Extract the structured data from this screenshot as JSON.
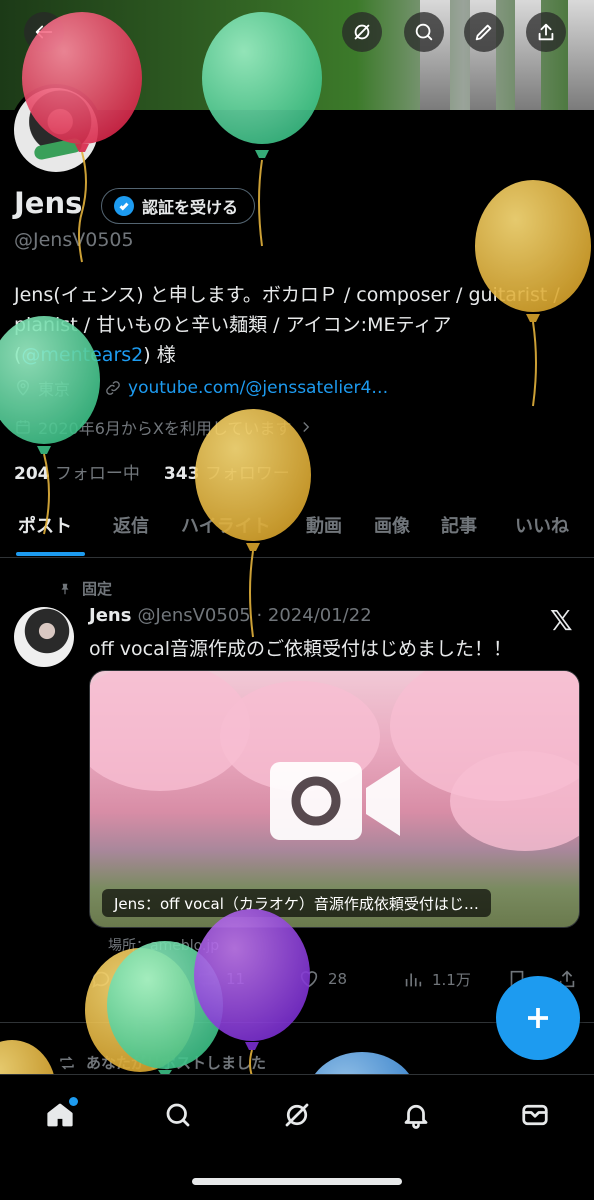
{
  "header": {
    "back_icon": "arrow-left-icon",
    "actions": [
      "grok-icon",
      "search-icon",
      "edit-icon",
      "share-icon"
    ]
  },
  "profile": {
    "name": "Jens",
    "verify_label": "認証を受ける",
    "handle": "@JensV0505",
    "bio_before": "Jens(イェンス) と申します。ボカロＰ / composer / guitarist / pianist / 甘いものと辛い麺類 / アイコン:MEティア (",
    "bio_mention": "@mentears2",
    "bio_after": ") 様",
    "location": "東京",
    "website": "youtube.com/@jenssatelier4…",
    "joined": "2020年6月からXを利用しています",
    "following_count": "204",
    "following_label": "フォロー中",
    "followers_count": "343",
    "followers_label": "フォロワー"
  },
  "tabs": [
    {
      "label": "ポスト",
      "active": true
    },
    {
      "label": "返信"
    },
    {
      "label": "ハイライト"
    },
    {
      "label": "動画"
    },
    {
      "label": "画像"
    },
    {
      "label": "記事"
    },
    {
      "label": "いいね"
    }
  ],
  "post": {
    "pinned_label": "固定",
    "author": "Jens",
    "handle_date": "@JensV0505 · 2024/01/22",
    "text": "off vocal音源作成のご依頼受付はじめました！！",
    "media_caption": "Jens：off vocal（カラオケ）音源作成依頼受付はじ…",
    "source": "場所：ameblo.jp",
    "replies": "",
    "reposts": "11",
    "likes": "28",
    "views": "1.1万"
  },
  "next_post": {
    "repost_label": "あなたがリポストしました"
  },
  "bottom_nav": [
    "home-icon",
    "search-icon",
    "grok-icon",
    "bell-icon",
    "mail-icon"
  ],
  "colors": {
    "accent": "#1d9bf0",
    "background": "#000000",
    "muted": "#71767b",
    "text": "#e7e9ea"
  }
}
